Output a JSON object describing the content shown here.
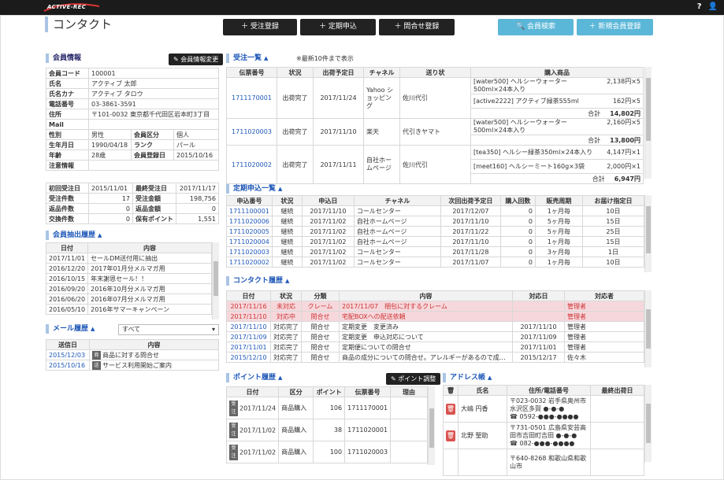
{
  "app": {
    "logo": "ACTIVE-REC",
    "help": "?",
    "user": "👤"
  },
  "page": {
    "title": "コンタクト"
  },
  "toolbar": {
    "order_reg": "＋ 受注登録",
    "subscription": "＋ 定期申込",
    "inquiry_reg": "＋ 問合せ登録",
    "member_search": "🔍 会員検索",
    "new_member": "＋ 新規会員登録"
  },
  "member": {
    "section": "会員情報",
    "change_btn": "✎ 会員情報変更",
    "rows": [
      [
        "会員コード",
        "100001"
      ],
      [
        "氏名",
        "アクティブ 太郎"
      ],
      [
        "氏名カナ",
        "アクティブ タロウ"
      ],
      [
        "電話番号",
        "03-3861-3591"
      ],
      [
        "住所",
        "〒101-0032 東京都千代田区岩本町3丁目"
      ],
      [
        "Mail",
        ""
      ]
    ],
    "row_gender": {
      "l1": "性別",
      "v1": "男性",
      "l2": "会員区分",
      "v2": "個人"
    },
    "row_birth": {
      "l1": "生年月日",
      "v1": "1990/04/18",
      "l2": "ランク",
      "v2": "パール"
    },
    "row_age": {
      "l1": "年齢",
      "v1": "28歳",
      "l2": "会員登録日",
      "v2": "2015/10/16"
    },
    "caution": "注意情報",
    "stats": [
      [
        "初回受注日",
        "2015/11/01",
        "最終受注日",
        "2017/11/17"
      ],
      [
        "受注件数",
        "17",
        "受注金額",
        "198,756"
      ],
      [
        "返品件数",
        "0",
        "返品金額",
        "0"
      ],
      [
        "交換件数",
        "0",
        "保有ポイント",
        "1,551"
      ]
    ]
  },
  "extract": {
    "section": "会員抽出履歴",
    "headers": [
      "日付",
      "内容"
    ],
    "rows": [
      [
        "2017/11/01",
        "セールDM送付用に抽出"
      ],
      [
        "2016/12/20",
        "2017年01月分メルマガ用"
      ],
      [
        "2016/10/15",
        "年末謝恩セール！！"
      ],
      [
        "2016/09/20",
        "2016年10月分メルマガ用"
      ],
      [
        "2016/06/20",
        "2016年07月分メルマガ用"
      ],
      [
        "2016/05/10",
        "2016年サマーキャンペーン"
      ]
    ]
  },
  "mail": {
    "section": "メール履歴",
    "filter": "すべて",
    "headers": [
      "送信日",
      "内容"
    ],
    "rows": [
      [
        "2015/12/03",
        "商",
        "商品に対する問合せ"
      ],
      [
        "2015/10/16",
        "送",
        "サービス利用開始ご案内"
      ]
    ]
  },
  "orders": {
    "section": "受注一覧",
    "note": "※最新10件まで表示",
    "headers": [
      "伝票番号",
      "状況",
      "出荷予定日",
      "チャネル",
      "送り状",
      "購入商品"
    ],
    "rows": [
      {
        "no": "1711170001",
        "st": "出荷完了",
        "date": "2017/11/24",
        "ch": "Yahoo ショッピング",
        "inv": "佐川代引",
        "items": [
          [
            "[water500] ヘルシーウォーター500ml×24本入り",
            "2,138円×5"
          ],
          [
            "[active2222] アクティブ緑茶555ml",
            "162円×5"
          ]
        ],
        "total": "14,802円"
      },
      {
        "no": "1711020003",
        "st": "出荷完了",
        "date": "2017/11/10",
        "ch": "楽天",
        "inv": "代引きヤマト",
        "items": [
          [
            "[water500] ヘルシーウォーター500ml×24本入り",
            "2,160円×5"
          ]
        ],
        "total": "13,800円"
      },
      {
        "no": "1711020002",
        "st": "出荷完了",
        "date": "2017/11/11",
        "ch": "自社ホームページ",
        "inv": "佐川代引",
        "items": [
          [
            "[tea350] ヘルシー緑茶350ml×24本入り",
            "4,147円×1"
          ],
          [
            "[meet160] ヘルシーミート160g×3袋",
            "2,000円×1"
          ]
        ],
        "total": "6,947円"
      }
    ],
    "total_label": "合計"
  },
  "subs": {
    "section": "定期申込一覧",
    "headers": [
      "申込番号",
      "状況",
      "申込日",
      "チャネル",
      "次回出荷予定日",
      "購入回数",
      "販売周期",
      "お届け指定日"
    ],
    "rows": [
      [
        "1711100001",
        "継続",
        "2017/11/10",
        "コールセンター",
        "2017/12/07",
        "0",
        "1ヶ月毎",
        "10日"
      ],
      [
        "1711020006",
        "継続",
        "2017/11/02",
        "自社ホームページ",
        "2017/11/10",
        "0",
        "5ヶ月毎",
        "15日"
      ],
      [
        "1711020005",
        "継続",
        "2017/11/02",
        "自社ホームページ",
        "2017/11/22",
        "0",
        "5ヶ月毎",
        "25日"
      ],
      [
        "1711020004",
        "継続",
        "2017/11/02",
        "自社ホームページ",
        "2017/11/10",
        "0",
        "1ヶ月毎",
        "15日"
      ],
      [
        "1711020003",
        "継続",
        "2017/11/02",
        "コールセンター",
        "2017/11/28",
        "0",
        "3ヶ月毎",
        "1日"
      ],
      [
        "1711020002",
        "継続",
        "2017/11/02",
        "コールセンター",
        "2017/11/07",
        "0",
        "1ヶ月毎",
        "10日"
      ]
    ]
  },
  "contact": {
    "section": "コンタクト履歴",
    "headers": [
      "日付",
      "状況",
      "分類",
      "内容",
      "対応日",
      "対応者"
    ],
    "rows": [
      [
        "2017/11/16",
        "未対応",
        "クレーム",
        "2017/11/07　梱包に対するクレーム",
        "",
        "管理者"
      ],
      [
        "2017/11/10",
        "対応中",
        "問合せ",
        "宅配BOXへの配送依頼",
        "",
        "管理者"
      ],
      [
        "2017/11/10",
        "対応完了",
        "問合せ",
        "定期変更　変更済み",
        "2017/11/10",
        "管理者"
      ],
      [
        "2017/11/09",
        "対応完了",
        "問合せ",
        "定期変更　申込対応について",
        "2017/11/09",
        "管理者"
      ],
      [
        "2017/11/01",
        "対応完了",
        "問合せ",
        "定期便についての問合せ",
        "2017/11/01",
        "管理者"
      ],
      [
        "2015/12/10",
        "対応完了",
        "問合せ",
        "商品の成分についての問合せ。アレルギーがあるので成…",
        "2015/12/17",
        "佐々木"
      ]
    ]
  },
  "points": {
    "section": "ポイント履歴",
    "adjust_btn": "✎ ポイント調整",
    "headers": [
      "日付",
      "区分",
      "ポイント",
      "伝票番号",
      "理由"
    ],
    "rows": [
      [
        "2017/11/24",
        "商品購入",
        "106",
        "1711170001"
      ],
      [
        "2017/11/02",
        "商品購入",
        "38",
        "1711020001"
      ],
      [
        "2017/11/02",
        "商品購入",
        "100",
        "1711020003"
      ]
    ],
    "tag": "受注"
  },
  "address": {
    "section": "アドレス帳",
    "headers": [
      "氏名",
      "住所/電話番号",
      "最終出荷日"
    ],
    "rows": [
      {
        "name": "大嶋 円香",
        "addr": "〒023-0032 岩手県奥州市水沢区多賀 ●-●-●",
        "tel": "☎ 0592-●●●-●●●●"
      },
      {
        "name": "北野 聖助",
        "addr": "〒731-0501 広島県安芸高田市吉田町吉田 ●-●-●",
        "tel": "☎ 082-●●●-●●●●"
      },
      {
        "name": "",
        "addr": "〒640-8268 和歌山県和歌山市",
        "tel": ""
      }
    ]
  }
}
